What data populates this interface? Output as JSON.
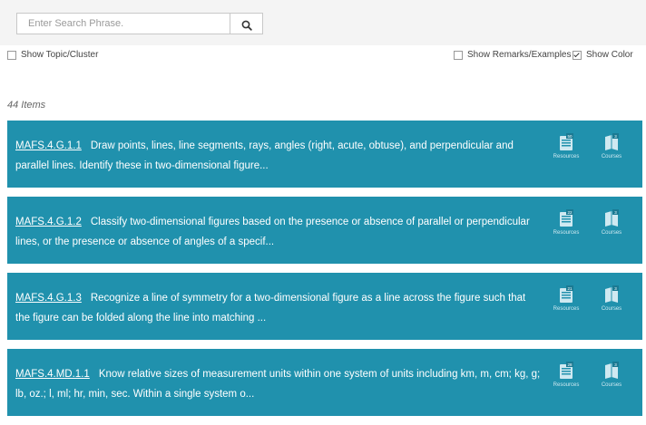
{
  "search": {
    "placeholder": "Enter Search Phrase.",
    "button_icon": "search-icon"
  },
  "options": {
    "show_topic_cluster": {
      "label": "Show Topic/Cluster",
      "checked": false
    },
    "show_remarks_examples": {
      "label": "Show Remarks/Examples",
      "checked": false
    },
    "show_color": {
      "label": "Show Color",
      "checked": true
    }
  },
  "results": {
    "count_label": "44 Items",
    "items": [
      {
        "code": "MAFS.4.G.1.1",
        "description": "Draw points, lines, line segments, rays, angles (right, acute, obtuse), and perpendicular and parallel lines. Identify these in two-dimensional figure...",
        "resources_label": "Resources",
        "resources_count": "50",
        "courses_label": "Courses",
        "courses_count": "3"
      },
      {
        "code": "MAFS.4.G.1.2",
        "description": "Classify two-dimensional figures based on the presence or absence of parallel or perpendicular lines, or the presence or absence of angles of a specif...",
        "resources_label": "Resources",
        "resources_count": "22",
        "courses_label": "Courses",
        "courses_count": "3"
      },
      {
        "code": "MAFS.4.G.1.3",
        "description": "Recognize a line of symmetry for a two-dimensional figure as a line across the figure such that the figure can be folded along the line into matching ...",
        "resources_label": "Resources",
        "resources_count": "21",
        "courses_label": "Courses",
        "courses_count": "3"
      },
      {
        "code": "MAFS.4.MD.1.1",
        "description": "Know relative sizes of measurement units within one system of units including km, m, cm; kg, g; lb, oz.; l, ml; hr, min, sec. Within a single system o...",
        "resources_label": "Resources",
        "resources_count": "28",
        "courses_label": "Courses",
        "courses_count": "3"
      }
    ]
  },
  "colors": {
    "card_bg": "#2091ad",
    "search_bar_bg": "#f4f4f4"
  }
}
